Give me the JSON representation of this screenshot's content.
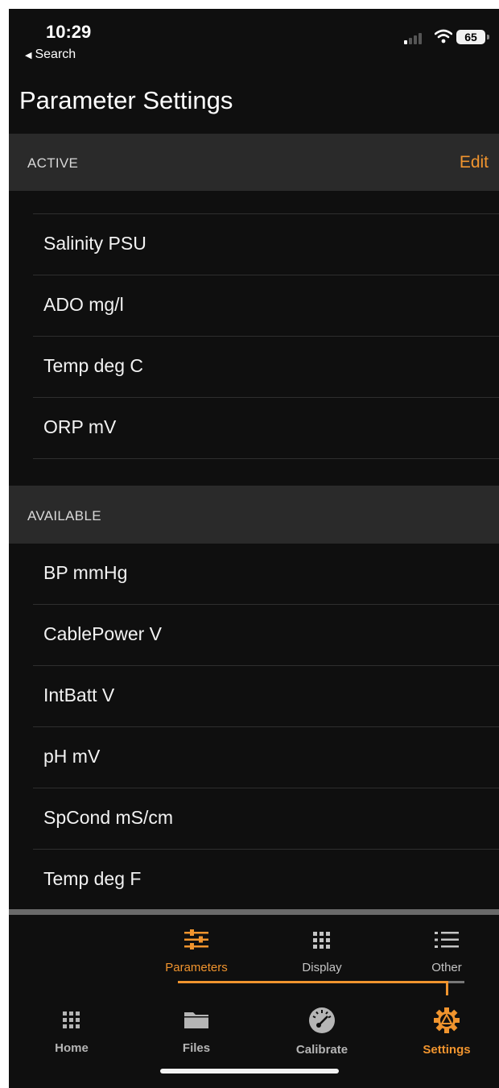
{
  "status_bar": {
    "time": "10:29",
    "back_label": "Search",
    "battery": "65"
  },
  "page_title": "Parameter Settings",
  "active_section": {
    "header": "ACTIVE",
    "edit_label": "Edit",
    "items": [
      "Salinity PSU",
      "ADO mg/l",
      "Temp deg C",
      "ORP mV"
    ]
  },
  "available_section": {
    "header": "AVAILABLE",
    "items": [
      "BP mmHg",
      "CablePower V",
      "IntBatt V",
      "pH mV",
      "SpCond mS/cm",
      "Temp deg F"
    ]
  },
  "sub_tabs": [
    {
      "label": "Parameters",
      "icon": "sliders-icon",
      "active": true
    },
    {
      "label": "Display",
      "icon": "grid-icon",
      "active": false
    },
    {
      "label": "Other",
      "icon": "list-icon",
      "active": false
    }
  ],
  "main_tabs": [
    {
      "label": "Home",
      "icon": "grid-icon",
      "active": false
    },
    {
      "label": "Files",
      "icon": "folder-icon",
      "active": false
    },
    {
      "label": "Calibrate",
      "icon": "gauge-icon",
      "active": false
    },
    {
      "label": "Settings",
      "icon": "gear-icon",
      "active": true
    }
  ],
  "colors": {
    "accent": "#f0942e",
    "background": "#0f0f0f",
    "section_header": "#2a2a2a"
  }
}
